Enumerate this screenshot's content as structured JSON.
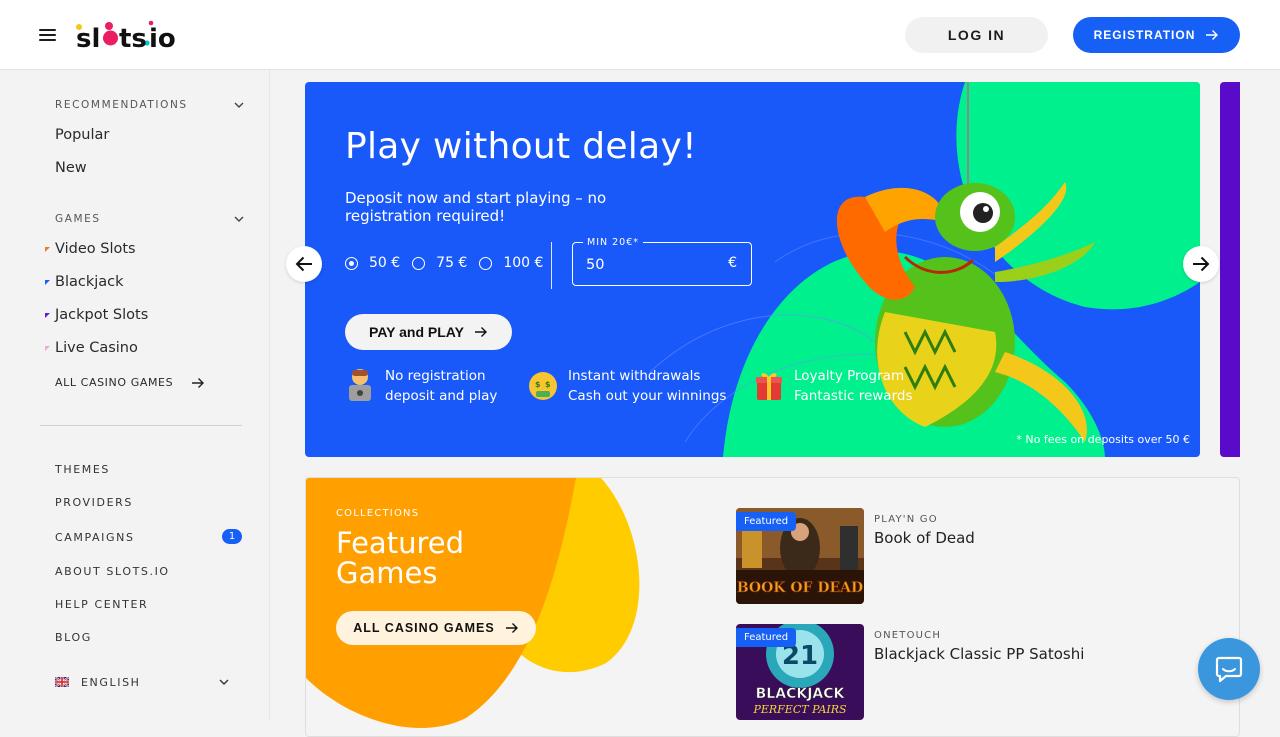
{
  "header": {
    "logo_text": "slots.io",
    "login_label": "LOG IN",
    "register_label": "REGISTRATION"
  },
  "sidebar": {
    "recommendations": {
      "title": "RECOMMENDATIONS",
      "items": [
        "Popular",
        "New"
      ]
    },
    "games": {
      "title": "GAMES",
      "items": [
        {
          "label": "Video Slots",
          "color": "#f07b2a"
        },
        {
          "label": "Blackjack",
          "color": "#1660f6"
        },
        {
          "label": "Jackpot Slots",
          "color": "#6a1bd1"
        },
        {
          "label": "Live Casino",
          "color": "#f2a6d6"
        }
      ],
      "all_label": "ALL CASINO GAMES"
    },
    "menu": {
      "themes": "THEMES",
      "providers": "PROVIDERS",
      "campaigns": "CAMPAIGNS",
      "campaigns_badge": "1",
      "about": "ABOUT SLOTS.IO",
      "help": "HELP CENTER",
      "blog": "BLOG"
    },
    "language": "ENGLISH"
  },
  "banner": {
    "title": "Play without delay!",
    "subtitle": "Deposit now and start playing – no registration required!",
    "options": [
      "50 €",
      "75 €",
      "100 €"
    ],
    "selected_option": "50 €",
    "amount_label": "MIN 20€*",
    "amount_value": "50",
    "currency": "€",
    "pay_label": "PAY and PLAY",
    "features": [
      {
        "line1": "No registration",
        "line2": "deposit and play"
      },
      {
        "line1": "Instant withdrawals",
        "line2": "Cash out your winnings"
      },
      {
        "line1": "Loyalty Program",
        "line2": "Fantastic rewards"
      }
    ],
    "fine_print": "* No fees on deposits over 50 €",
    "bg_color": "#1959fa",
    "accent_color": "#00f08e"
  },
  "collection": {
    "eyebrow": "COLLECTIONS",
    "title": "Featured Games",
    "all_label": "ALL CASINO GAMES",
    "games": [
      {
        "badge": "Featured",
        "provider": "PLAY'N GO",
        "name": "Book of Dead",
        "thumb_text": "BOOK OF DEAD"
      },
      {
        "badge": "Featured",
        "provider": "ONETOUCH",
        "name": "Blackjack Classic PP Satoshi",
        "thumb_text": "BLACKJACK",
        "thumb_sub": "PERFECT PAIRS",
        "thumb_num": "21"
      }
    ]
  }
}
